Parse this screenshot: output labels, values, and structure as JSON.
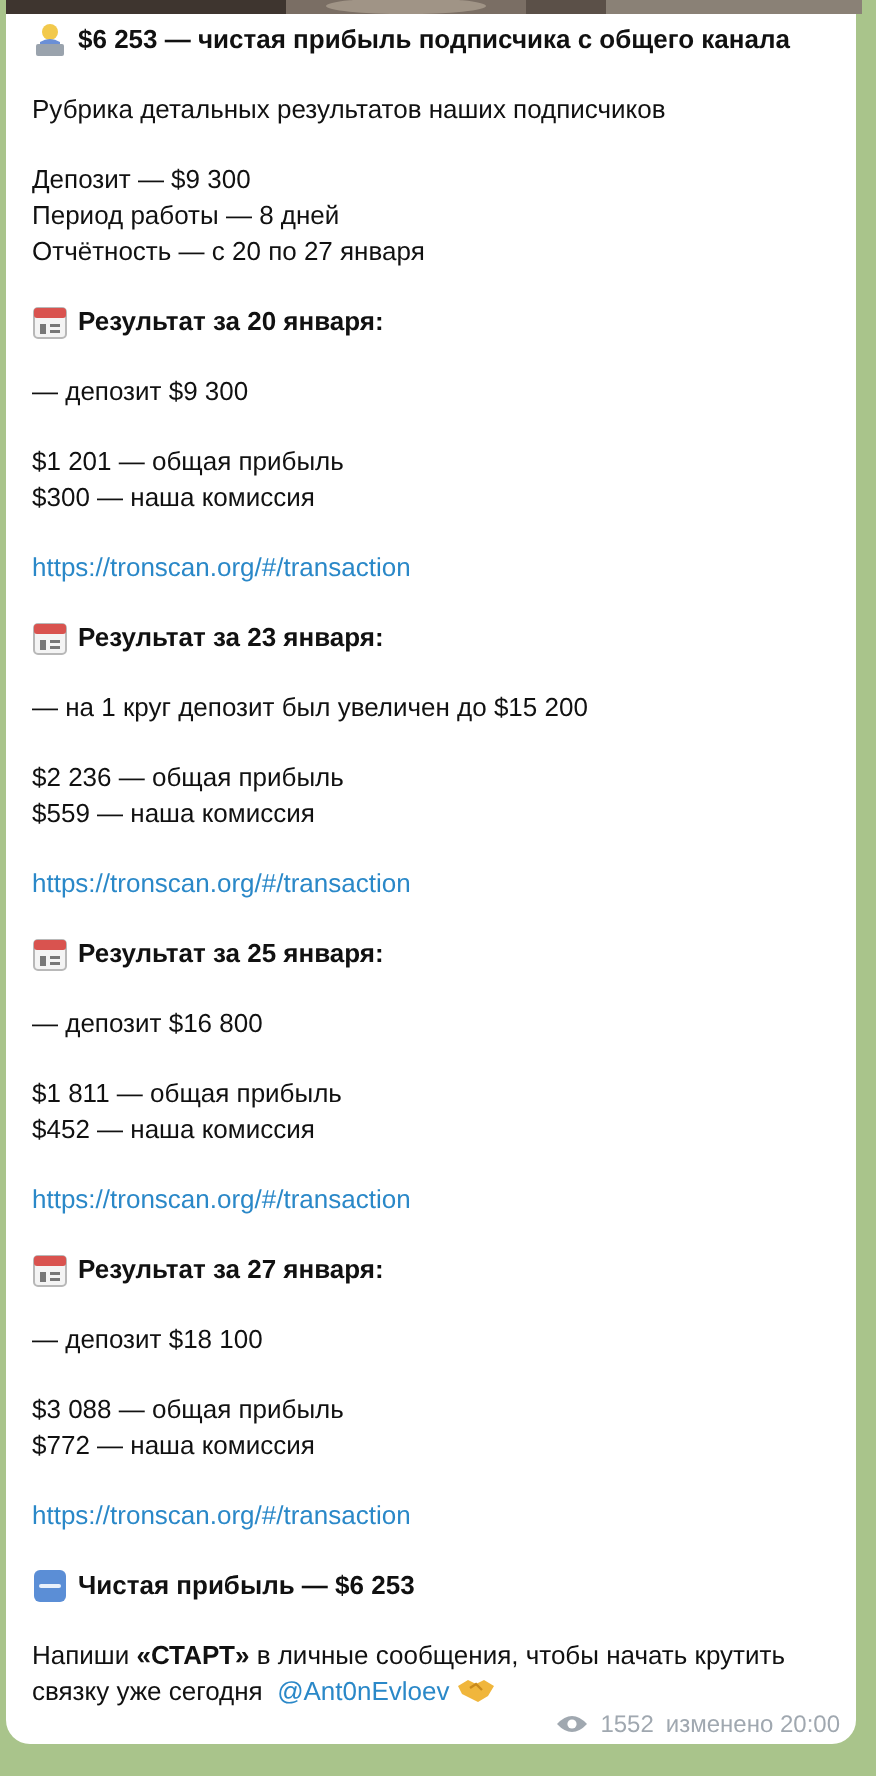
{
  "message": {
    "title": "$6 253 — чистая прибыль подписчика с общего канала",
    "subtitle": "Рубрика детальных результатов наших подписчиков",
    "summary": [
      "Депозит — $9 300",
      "Период работы — 8 дней",
      "Отчётность — с 20 по 27 января"
    ],
    "results": [
      {
        "heading": "Результат за 20 января:",
        "deposit": "— депозит $9 300",
        "profit": "$1 201 — общая прибыль",
        "commission": "$300 — наша комиссия",
        "link": "https://tronscan.org/#/transaction"
      },
      {
        "heading": "Результат за 23 января:",
        "deposit": "— на 1 круг депозит был увеличен до $15 200",
        "profit": "$2 236 — общая прибыль",
        "commission": "$559 — наша комиссия",
        "link": "https://tronscan.org/#/transaction"
      },
      {
        "heading": "Результат за 25 января:",
        "deposit": "— депозит $16 800",
        "profit": "$1 811 — общая прибыль",
        "commission": "$452 — наша комиссия",
        "link": "https://tronscan.org/#/transaction"
      },
      {
        "heading": "Результат за 27 января:",
        "deposit": "— депозит $18 100",
        "profit": "$3 088 — общая прибыль",
        "commission": "$772 — наша комиссия",
        "link": "https://tronscan.org/#/transaction"
      }
    ],
    "total": "Чистая прибыль — $6 253",
    "call_to_action": "Напиши **«СТАРТ»** в личные сообщения, чтобы начать крутить связку уже сегодня",
    "mention": "@Ant0nEvloev",
    "views": "1552",
    "edited": "изменено 20:00"
  }
}
